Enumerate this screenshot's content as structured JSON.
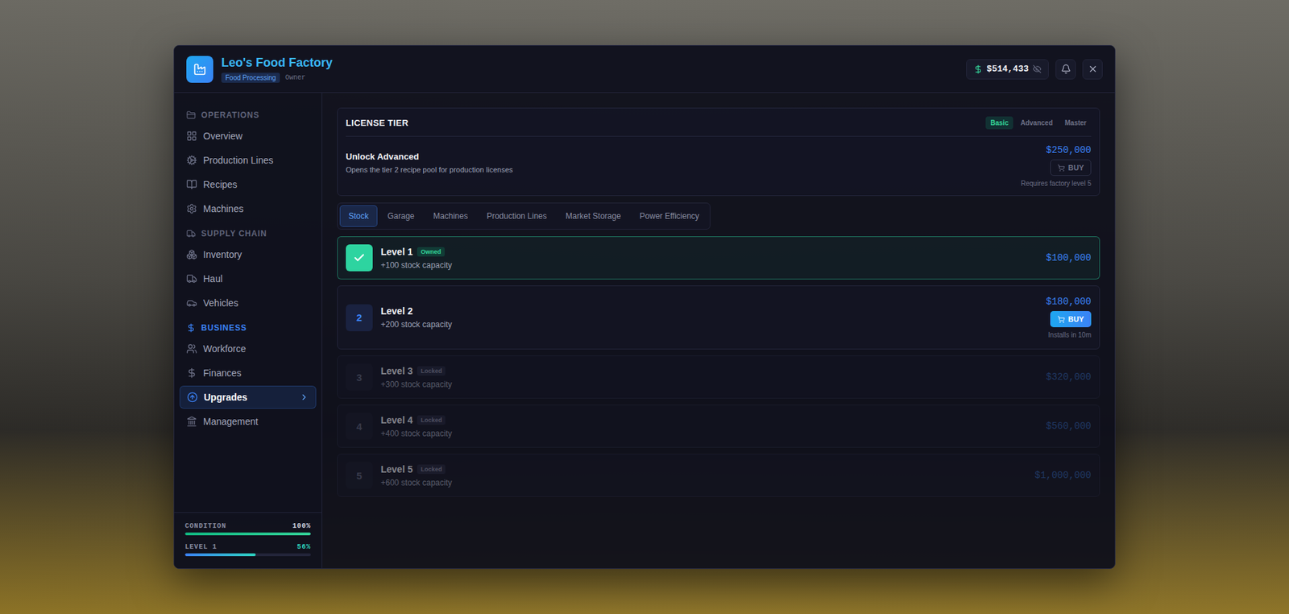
{
  "window": {
    "title": "Leo's Food Factory",
    "category": "Food Processing",
    "role": "Owner",
    "balance": "$514,433"
  },
  "sidebar": {
    "sections": [
      {
        "title": "OPERATIONS",
        "items": [
          {
            "label": "Overview",
            "selected": false
          },
          {
            "label": "Production Lines",
            "selected": false
          },
          {
            "label": "Recipes",
            "selected": false
          },
          {
            "label": "Machines",
            "selected": false
          }
        ]
      },
      {
        "title": "SUPPLY CHAIN",
        "items": [
          {
            "label": "Inventory",
            "selected": false
          },
          {
            "label": "Haul",
            "selected": false
          },
          {
            "label": "Vehicles",
            "selected": false
          }
        ]
      },
      {
        "title": "BUSINESS",
        "items": [
          {
            "label": "Workforce",
            "selected": false
          },
          {
            "label": "Finances",
            "selected": false
          },
          {
            "label": "Upgrades",
            "selected": true
          },
          {
            "label": "Management",
            "selected": false
          }
        ]
      }
    ],
    "meters": [
      {
        "label": "CONDITION",
        "reading": "100%",
        "level": 1.0,
        "kind": "condition"
      },
      {
        "label": "LEVEL 1",
        "reading": "56%",
        "level": 0.56,
        "kind": "level"
      }
    ]
  },
  "license": {
    "title": "LICENSE TIER",
    "tiers": [
      {
        "label": "Basic",
        "selected": true
      },
      {
        "label": "Advanced",
        "selected": false
      },
      {
        "label": "Master",
        "selected": false
      }
    ],
    "offer": {
      "title": "Unlock Advanced",
      "description": "Opens the tier 2 recipe pool for production licenses",
      "price": "$250,000",
      "button": "BUY",
      "disabled": true,
      "note": "Requires factory level 5"
    }
  },
  "tabs": [
    {
      "label": "Stock",
      "selected": true
    },
    {
      "label": "Garage",
      "selected": false
    },
    {
      "label": "Machines",
      "selected": false
    },
    {
      "label": "Production Lines",
      "selected": false
    },
    {
      "label": "Market Storage",
      "selected": false
    },
    {
      "label": "Power Efficiency",
      "selected": false
    }
  ],
  "levels": [
    {
      "title": "Level 1",
      "kind": "owned",
      "badge": "Owned",
      "description": "+100 stock capacity",
      "price": "$100,000"
    },
    {
      "title": "Level 2",
      "kind": "available",
      "number": "2",
      "description": "+200 stock capacity",
      "price": "$180,000",
      "button": "BUY",
      "note": "Installs in 10m"
    },
    {
      "title": "Level 3",
      "kind": "locked",
      "number": "3",
      "badge": "Locked",
      "description": "+300 stock capacity",
      "price": "$320,000"
    },
    {
      "title": "Level 4",
      "kind": "locked",
      "number": "4",
      "badge": "Locked",
      "description": "+400 stock capacity",
      "price": "$560,000"
    },
    {
      "title": "Level 5",
      "kind": "locked",
      "number": "5",
      "badge": "Locked",
      "description": "+600 stock capacity",
      "price": "$1,000,000"
    }
  ]
}
